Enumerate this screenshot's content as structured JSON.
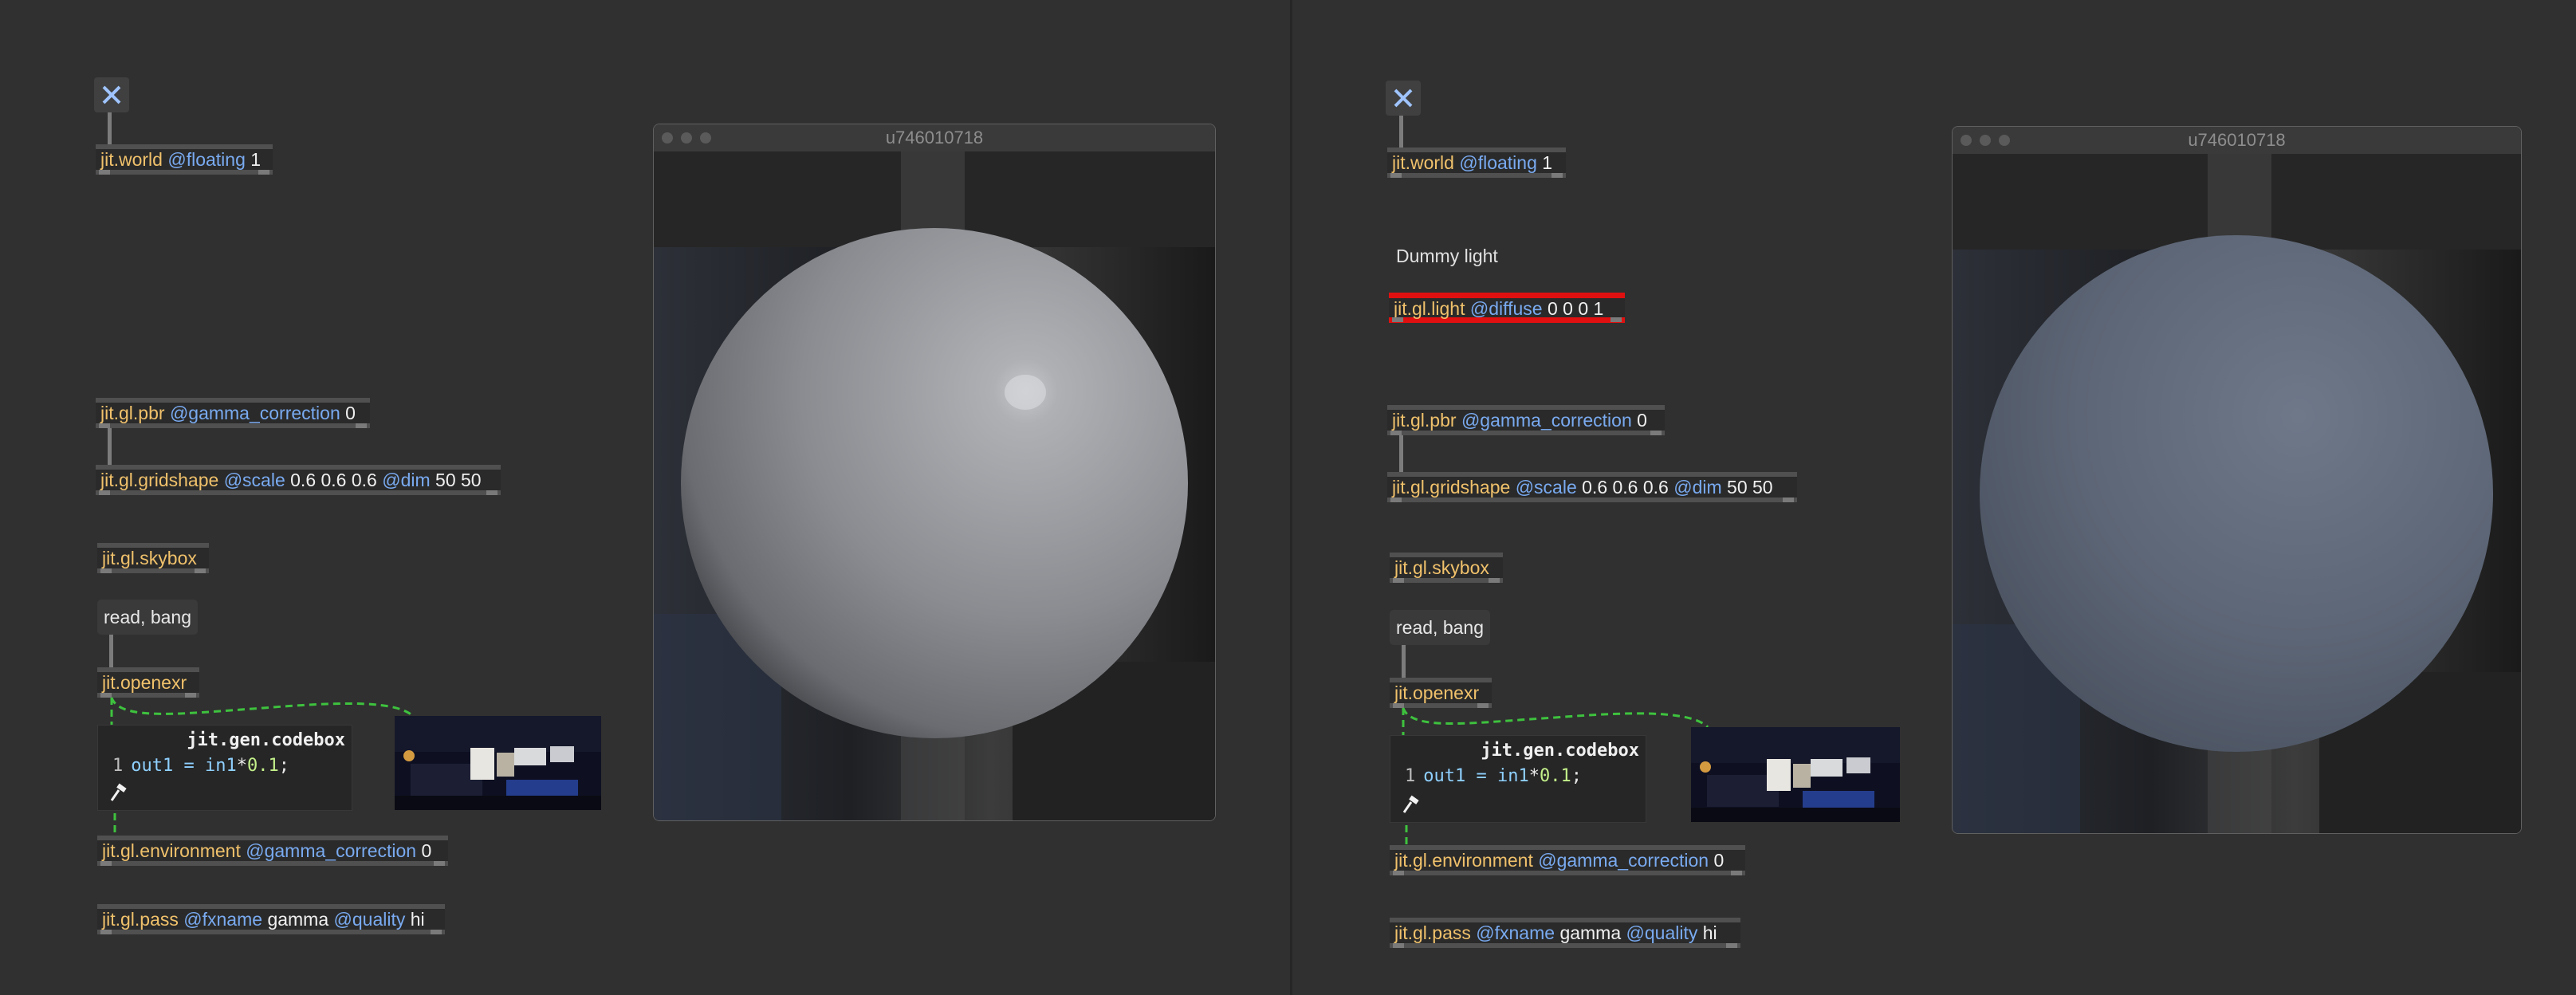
{
  "left_patch": {
    "world": {
      "name": "jit.world",
      "attr": "@floating",
      "val": "1"
    },
    "pbr": {
      "name": "jit.gl.pbr",
      "attr": "@gamma_correction",
      "val": "0"
    },
    "gridshape": {
      "name": "jit.gl.gridshape",
      "attr1": "@scale",
      "val1": "0.6 0.6 0.6",
      "attr2": "@dim",
      "val2": "50 50"
    },
    "skybox": {
      "name": "jit.gl.skybox"
    },
    "message": "read, bang",
    "openexr": {
      "name": "jit.openexr"
    },
    "codebox": {
      "title": "jit.gen.codebox",
      "line": "1",
      "code_a": "out1 = ",
      "code_b": "in1",
      "code_c": "*",
      "code_d": "0.1",
      ";": ";"
    },
    "environment": {
      "name": "jit.gl.environment",
      "attr": "@gamma_correction",
      "val": "0"
    },
    "pass": {
      "name": "jit.gl.pass",
      "attr1": "@fxname",
      "val1": "gamma",
      "attr2": "@quality",
      "val2": "hi"
    },
    "window": {
      "title": "u746010718"
    }
  },
  "right_patch": {
    "world": {
      "name": "jit.world",
      "attr": "@floating",
      "val": "1"
    },
    "comment": "Dummy light",
    "light": {
      "name": "jit.gl.light",
      "attr": "@diffuse",
      "val": "0 0 0 1"
    },
    "pbr": {
      "name": "jit.gl.pbr",
      "attr": "@gamma_correction",
      "val": "0"
    },
    "gridshape": {
      "name": "jit.gl.gridshape",
      "attr1": "@scale",
      "val1": "0.6 0.6 0.6",
      "attr2": "@dim",
      "val2": "50 50"
    },
    "skybox": {
      "name": "jit.gl.skybox"
    },
    "message": "read, bang",
    "openexr": {
      "name": "jit.openexr"
    },
    "codebox": {
      "title": "jit.gen.codebox",
      "line": "1",
      "code_a": "out1 = ",
      "code_b": "in1",
      "code_c": "*",
      "code_d": "0.1",
      ";": ";"
    },
    "environment": {
      "name": "jit.gl.environment",
      "attr": "@gamma_correction",
      "val": "0"
    },
    "pass": {
      "name": "jit.gl.pass",
      "attr1": "@fxname",
      "val1": "gamma",
      "attr2": "@quality",
      "val2": "hi"
    },
    "window": {
      "title": "u746010718"
    }
  },
  "colors": {
    "object_name": "#f0c16b",
    "attribute": "#79aaf0",
    "selected": "#e01010",
    "cord_signal": "#3ec23e"
  },
  "icons": [
    "close-x-icon",
    "hammer-icon",
    "traffic-light-dots"
  ]
}
